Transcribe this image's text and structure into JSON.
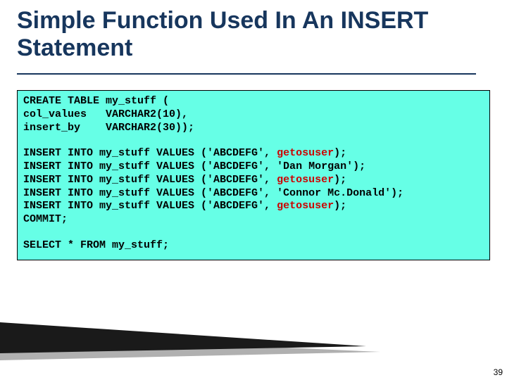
{
  "title": "Simple Function Used In An INSERT Statement",
  "code": {
    "blocks": [
      {
        "lines": [
          {
            "pre": "CREATE TABLE my_stuff (",
            "red": ""
          },
          {
            "pre": "col_values   VARCHAR2(10),",
            "red": ""
          },
          {
            "pre": "insert_by    VARCHAR2(30));",
            "red": ""
          }
        ]
      },
      {
        "lines": [
          {
            "pre": "INSERT INTO my_stuff VALUES ('ABCDEFG', ",
            "red": "getosuser",
            "post": ");"
          },
          {
            "pre": "INSERT INTO my_stuff VALUES ('ABCDEFG', 'Dan Morgan');",
            "red": ""
          },
          {
            "pre": "INSERT INTO my_stuff VALUES ('ABCDEFG', ",
            "red": "getosuser",
            "post": ");"
          },
          {
            "pre": "INSERT INTO my_stuff VALUES ('ABCDEFG', 'Connor Mc.Donald');",
            "red": ""
          },
          {
            "pre": "INSERT INTO my_stuff VALUES ('ABCDEFG', ",
            "red": "getosuser",
            "post": ");"
          },
          {
            "pre": "COMMIT;",
            "red": ""
          }
        ]
      },
      {
        "lines": [
          {
            "pre": "SELECT * FROM my_stuff;",
            "red": ""
          }
        ]
      }
    ]
  },
  "page_number": "39"
}
